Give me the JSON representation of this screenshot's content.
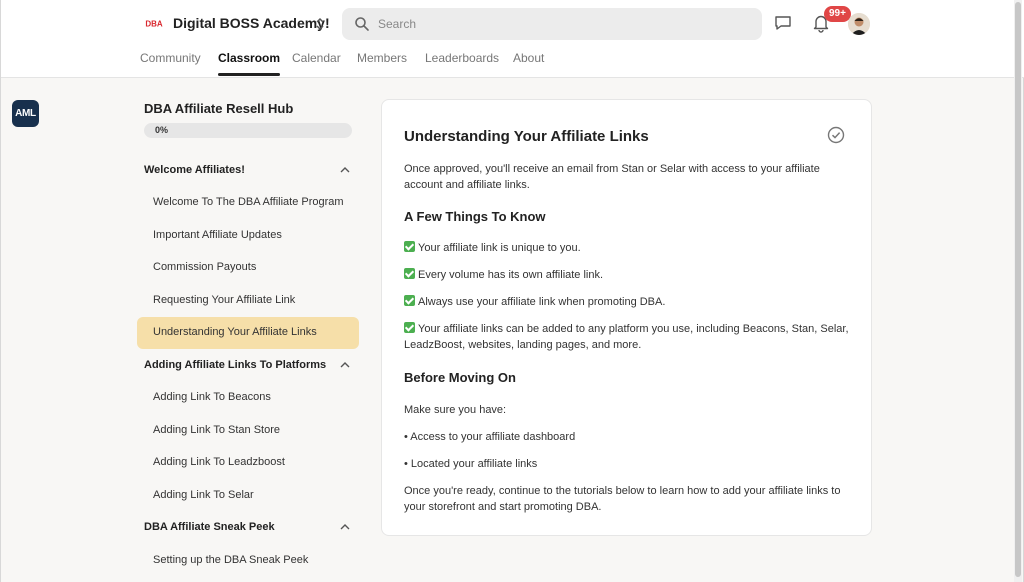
{
  "header": {
    "app_title": "Digital BOSS Academy!",
    "logo_text": "DBA",
    "search_placeholder": "Search",
    "notification_count": "99+",
    "tabs": [
      {
        "label": "Community",
        "active": false
      },
      {
        "label": "Classroom",
        "active": true
      },
      {
        "label": "Calendar",
        "active": false
      },
      {
        "label": "Members",
        "active": false
      },
      {
        "label": "Leaderboards",
        "active": false
      },
      {
        "label": "About",
        "active": false
      }
    ]
  },
  "rail": {
    "logo_text": "AML"
  },
  "sidebar": {
    "course_title": "DBA Affiliate Resell Hub",
    "progress_text": "0%",
    "progress_value": 0,
    "sections": [
      {
        "title": "Welcome Affiliates!",
        "lessons": [
          {
            "label": "Welcome To The DBA Affiliate Program",
            "active": false
          },
          {
            "label": "Important Affiliate Updates",
            "active": false
          },
          {
            "label": "Commission Payouts",
            "active": false
          },
          {
            "label": "Requesting Your Affiliate Link",
            "active": false
          },
          {
            "label": "Understanding Your Affiliate Links",
            "active": true
          }
        ]
      },
      {
        "title": "Adding Affiliate Links To Platforms",
        "lessons": [
          {
            "label": "Adding Link To Beacons",
            "active": false
          },
          {
            "label": "Adding Link To Stan Store",
            "active": false
          },
          {
            "label": "Adding Link To Leadzboost",
            "active": false
          },
          {
            "label": "Adding Link To Selar",
            "active": false
          }
        ]
      },
      {
        "title": "DBA Affiliate Sneak Peek",
        "lessons": [
          {
            "label": "Setting up the DBA Sneak Peek",
            "active": false
          }
        ]
      }
    ]
  },
  "lesson": {
    "title": "Understanding Your Affiliate Links",
    "intro": "Once approved, you'll receive an email from Stan or Selar with access to your affiliate account and affiliate links.",
    "section1_title": "A Few Things To Know",
    "checks": [
      "Your affiliate link is unique to you.",
      "Every volume has its own affiliate link.",
      "Always use your affiliate link when promoting DBA.",
      "Your affiliate links can be added to any platform you use, including Beacons, Stan, Selar, LeadzBoost, websites, landing pages, and more."
    ],
    "section2_title": "Before Moving On",
    "make_sure": "Make sure you have:",
    "bullets": [
      "• Access to your affiliate dashboard",
      "• Located your affiliate links"
    ],
    "outro": "Once you're ready, continue to the tutorials below to learn how to add your affiliate links to your storefront and start promoting DBA."
  },
  "colors": {
    "accent_active": "#f6dfa9",
    "badge": "#e04646",
    "check_green": "#4caf50"
  }
}
